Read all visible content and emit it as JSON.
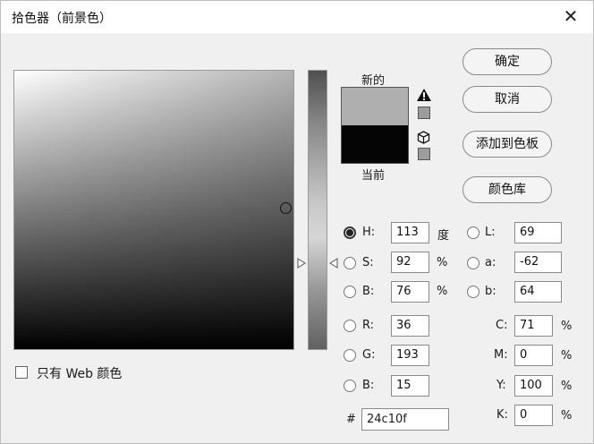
{
  "window": {
    "title": "拾色器（前景色）",
    "close_glyph": "✕"
  },
  "preview": {
    "new_label": "新的",
    "current_label": "当前",
    "new_color": "#afafaf",
    "current_color": "#050505"
  },
  "buttons": {
    "ok": "确定",
    "cancel": "取消",
    "add_to_swatches": "添加到色板",
    "color_libraries": "颜色库"
  },
  "hsb": {
    "h": {
      "label": "H:",
      "value": "113",
      "unit": "度",
      "selected": true
    },
    "s": {
      "label": "S:",
      "value": "92",
      "unit": "%"
    },
    "b": {
      "label": "B:",
      "value": "76",
      "unit": "%"
    }
  },
  "rgb": {
    "r": {
      "label": "R:",
      "value": "36"
    },
    "g": {
      "label": "G:",
      "value": "193"
    },
    "b": {
      "label": "B:",
      "value": "15"
    }
  },
  "lab": {
    "l": {
      "label": "L:",
      "value": "69"
    },
    "a": {
      "label": "a:",
      "value": "-62"
    },
    "b": {
      "label": "b:",
      "value": "64"
    }
  },
  "cmyk": {
    "c": {
      "label": "C:",
      "value": "71",
      "unit": "%"
    },
    "m": {
      "label": "M:",
      "value": "0",
      "unit": "%"
    },
    "y": {
      "label": "Y:",
      "value": "100",
      "unit": "%"
    },
    "k": {
      "label": "K:",
      "value": "0",
      "unit": "%"
    }
  },
  "hex": {
    "sign": "#",
    "value": "24c10f"
  },
  "web_only": {
    "label": "只有 Web 颜色",
    "checked": false
  },
  "icons": {
    "gamut_warning": "warning-icon",
    "web_safe": "cube-icon"
  }
}
